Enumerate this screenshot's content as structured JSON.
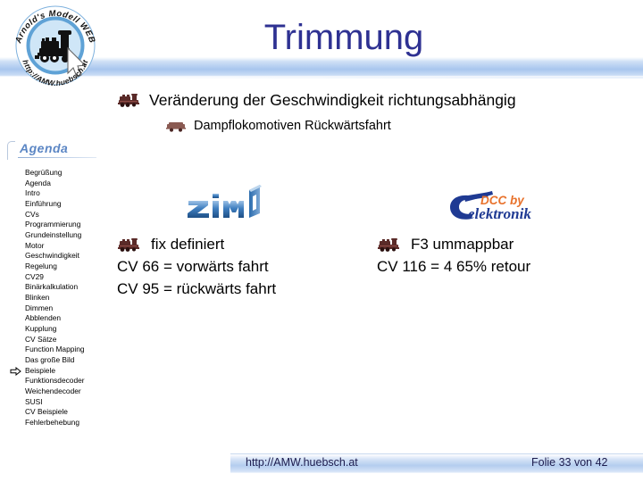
{
  "slide": {
    "title": "Trimmung",
    "logo": {
      "alt": "amw-round-logo",
      "top_text": "Arnold's Modell WEB",
      "bottom_text": "http://AMW.huebsch.at"
    },
    "bullets": [
      {
        "icon": "steam-locomotive-icon",
        "text": "Veränderung der Geschwindigkeit richtungsabhängig"
      },
      {
        "icon": "wagon-icon",
        "text": "Dampflokomotiven Rückwärtsfahrt"
      }
    ],
    "agenda": {
      "heading": "Agenda",
      "current_marker": "right-arrow-marker",
      "items": [
        {
          "label": "Begrüßung",
          "current": false
        },
        {
          "label": "Agenda",
          "current": false
        },
        {
          "label": "Intro",
          "current": false
        },
        {
          "label": "Einführung",
          "current": false
        },
        {
          "label": "CVs",
          "current": false
        },
        {
          "label": "Programmierung",
          "current": false
        },
        {
          "label": "Grundeinstellung",
          "current": false
        },
        {
          "label": "Motor",
          "current": false
        },
        {
          "label": "Geschwindigkeit",
          "current": false
        },
        {
          "label": "Regelung",
          "current": false
        },
        {
          "label": "CV29",
          "current": false
        },
        {
          "label": "Binärkalkulation",
          "current": false
        },
        {
          "label": "Blinken",
          "current": false
        },
        {
          "label": "Dimmen",
          "current": false
        },
        {
          "label": "Abblenden",
          "current": false
        },
        {
          "label": "Kupplung",
          "current": false
        },
        {
          "label": "CV Sätze",
          "current": false
        },
        {
          "label": "Function Mapping",
          "current": false
        },
        {
          "label": "Das große Bild",
          "current": false
        },
        {
          "label": "Beispiele",
          "current": true
        },
        {
          "label": "Funktionsdecoder",
          "current": false
        },
        {
          "label": "Weichendecoder",
          "current": false
        },
        {
          "label": "SUSI",
          "current": false
        },
        {
          "label": "CV Beispiele",
          "current": false
        },
        {
          "label": "Fehlerbehebung",
          "current": false
        }
      ]
    },
    "brands": {
      "zimo": {
        "name": "zimo-logo",
        "text": "zimo"
      },
      "ct": {
        "name": "ct-elektronik-logo",
        "tagline": "DCC by",
        "text": "elektronik",
        "mark": "CT"
      }
    },
    "columns": {
      "left": {
        "icon": "steam-locomotive-icon",
        "heading": "fix definiert",
        "lines": [
          "CV 66 = vorwärts fahrt",
          "CV 95 = rückwärts fahrt"
        ]
      },
      "right": {
        "icon": "steam-locomotive-icon",
        "heading": "F3 ummappbar",
        "lines": [
          "CV 116 = 4 65% retour"
        ]
      }
    },
    "footer": {
      "url": "http://AMW.huebsch.at",
      "page": "Folie 33 von 42"
    },
    "colors": {
      "title": "#2e3192",
      "band": "#a8c6ee",
      "agenda_heading": "#5b86c4",
      "loco": "#5a2a28",
      "zimo_blue": "#2f6fb5",
      "ct_orange": "#e8722c",
      "ct_blue": "#1f3a93",
      "footer_text": "#1c1c4e"
    }
  }
}
